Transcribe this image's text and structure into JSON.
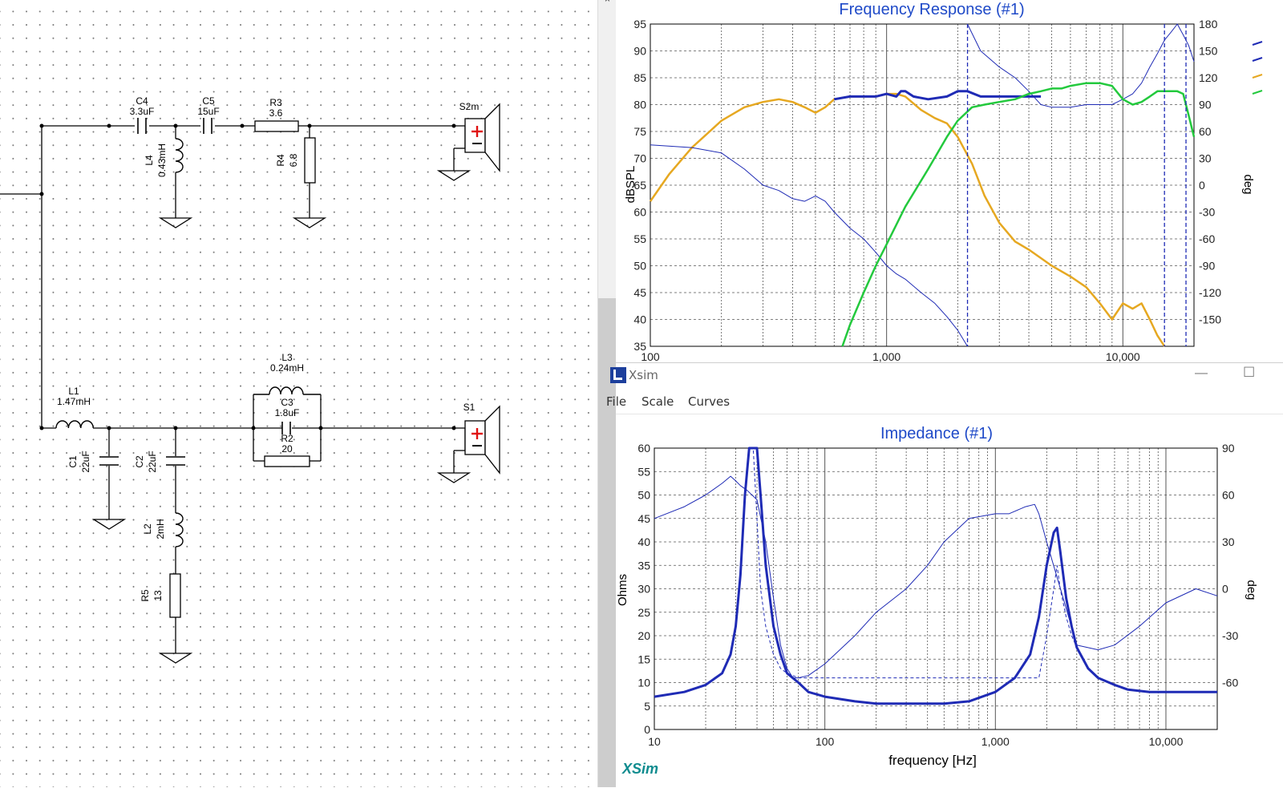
{
  "colors": {
    "blue": "#1f2bb5",
    "orange": "#e6a821",
    "green": "#23c93d",
    "title_blue": "#1f4ac8",
    "brand": "#0f8c8f",
    "speaker_plus": "#e01010"
  },
  "schematic": {
    "c4": {
      "name": "C4",
      "value": "3.3uF"
    },
    "c5": {
      "name": "C5",
      "value": "15uF"
    },
    "r3": {
      "name": "R3",
      "value": "3.6"
    },
    "l4": {
      "name": "L4",
      "value": "0.43mH"
    },
    "r4": {
      "name": "R4",
      "value": "6.8"
    },
    "s2m": {
      "name": "S2m"
    },
    "l1": {
      "name": "L1",
      "value": "1.47mH"
    },
    "l3": {
      "name": "L3",
      "value": "0.24mH"
    },
    "c3": {
      "name": "C3",
      "value": "1.8uF"
    },
    "r2": {
      "name": "R2",
      "value": "20"
    },
    "s1": {
      "name": "S1"
    },
    "c1": {
      "name": "C1",
      "value": "22uF"
    },
    "c2": {
      "name": "C2",
      "value": "22uF"
    },
    "l2": {
      "name": "L2",
      "value": "2mH"
    },
    "r5": {
      "name": "R5",
      "value": "13"
    }
  },
  "splitter": {
    "arrow": "⌃"
  },
  "xsim_window": {
    "title": "Xsim",
    "icon": "xsim-app-icon",
    "minimize": "—",
    "maximize": "☐",
    "menu": {
      "file": "File",
      "scale": "Scale",
      "curves": "Curves"
    },
    "brand": "XSim"
  },
  "chart_data": [
    {
      "type": "line",
      "title": "Frequency Response (#1)",
      "xscale": "log",
      "xlim": [
        100,
        20000
      ],
      "xticks_visible": [
        "100",
        "1,000",
        "10,000"
      ],
      "ylabel": "dBSPL",
      "ylim": [
        35,
        95
      ],
      "yticks": [
        35,
        40,
        45,
        50,
        55,
        60,
        65,
        70,
        75,
        80,
        85,
        90,
        95
      ],
      "y2label": "deg",
      "y2lim": [
        -180,
        180
      ],
      "y2ticks": [
        -150,
        -120,
        -90,
        -60,
        -30,
        0,
        30,
        60,
        90,
        120,
        150,
        180
      ],
      "grid": true,
      "series": [
        {
          "color": "#e6a821",
          "x": [
            100,
            120,
            150,
            200,
            250,
            300,
            350,
            400,
            450,
            500,
            550,
            600,
            700,
            800,
            900,
            1000,
            1100,
            1200,
            1400,
            1600,
            1800,
            2000,
            2300,
            2600,
            3000,
            3500,
            4000,
            5000,
            6000,
            7000,
            8000,
            9000,
            10000,
            11000,
            12000,
            13000,
            14000,
            15000
          ],
          "y": [
            62,
            67,
            72,
            77,
            79.5,
            80.5,
            81,
            80.5,
            79.5,
            78.5,
            79.5,
            81,
            81.5,
            81.5,
            81.5,
            82,
            82,
            81.5,
            79,
            77.5,
            76.5,
            74,
            69,
            63,
            58,
            54.5,
            53,
            50,
            48,
            46,
            43,
            40,
            43,
            42,
            43,
            40,
            37,
            35
          ]
        },
        {
          "color": "#1f2bb5",
          "width": 3,
          "x": [
            600,
            700,
            800,
            900,
            1000,
            1100,
            1150,
            1200,
            1300,
            1500,
            1800,
            2000,
            2200,
            2500,
            3000,
            3500,
            4000,
            4500
          ],
          "y": [
            81,
            81.5,
            81.5,
            81.5,
            82,
            81.5,
            82.5,
            82.5,
            81.5,
            81,
            81.5,
            82.5,
            82.5,
            81.5,
            81.5,
            81.5,
            81.5,
            81.5
          ]
        },
        {
          "color": "#1f2bb5",
          "width": 1,
          "x": [
            100,
            150,
            200,
            250,
            300,
            350,
            400,
            450,
            500,
            550,
            600,
            700,
            800,
            900,
            1000,
            1100,
            1200,
            1400,
            1600,
            1800,
            2000,
            2200
          ],
          "y": [
            72.5,
            72,
            71,
            68,
            65,
            64,
            62.5,
            62,
            63,
            62,
            60,
            57,
            55,
            52.5,
            50,
            48.5,
            47.5,
            45,
            43,
            40.5,
            38,
            35
          ]
        },
        {
          "color": "#1f2bb5",
          "width": 1,
          "x": [
            2200,
            2500,
            3000,
            3500,
            4000,
            4500,
            5000,
            6000,
            7000,
            8000,
            9000,
            10000,
            11000,
            12000,
            13000,
            14000,
            15000,
            16000,
            17000,
            18000,
            19000,
            20000
          ],
          "y": [
            95,
            90,
            87,
            85,
            82.5,
            80,
            79.5,
            79.5,
            80,
            80,
            80,
            81,
            82,
            84,
            87,
            89.5,
            92,
            93.5,
            95,
            93,
            91,
            88
          ]
        },
        {
          "color": "#23c93d",
          "x": [
            650,
            700,
            800,
            900,
            1000,
            1200,
            1500,
            1800,
            2000,
            2300,
            2600,
            3000,
            3500,
            4000,
            4500,
            5000,
            5500,
            6000,
            7000,
            8000,
            9000,
            10000,
            11000,
            12000,
            13000,
            14000,
            15000,
            16000,
            17000,
            18000,
            19000,
            20000
          ],
          "y": [
            35,
            39,
            45,
            50,
            54,
            61,
            68,
            74,
            77,
            79.5,
            80,
            80.5,
            81,
            82,
            82.5,
            83,
            83,
            83.5,
            84,
            84,
            83.5,
            81,
            80,
            80.5,
            81.5,
            82.5,
            82.5,
            82.5,
            82.5,
            82,
            78,
            74
          ]
        }
      ],
      "markers_x": [
        2200,
        15000,
        18500
      ]
    },
    {
      "type": "line",
      "title": "Impedance (#1)",
      "xlabel": "frequency [Hz]",
      "xscale": "log",
      "xlim": [
        10,
        20000
      ],
      "xticks": [
        "10",
        "100",
        "1,000",
        "10,000"
      ],
      "ylabel": "Ohms",
      "ylim": [
        0,
        60
      ],
      "yticks": [
        0,
        5,
        10,
        15,
        20,
        25,
        30,
        35,
        40,
        45,
        50,
        55,
        60
      ],
      "y2label": "deg",
      "y2lim": [
        -90,
        90
      ],
      "y2ticks": [
        -60,
        -30,
        0,
        30,
        60,
        90
      ],
      "grid": true,
      "series": [
        {
          "color": "#1f2bb5",
          "width": 3,
          "x": [
            10,
            15,
            20,
            25,
            28,
            30,
            32,
            34,
            36,
            38,
            40,
            42,
            45,
            50,
            55,
            60,
            70,
            80,
            100,
            150,
            200,
            300,
            500,
            700,
            1000,
            1300,
            1600,
            1800,
            2000,
            2200,
            2300,
            2400,
            2600,
            2800,
            3000,
            3500,
            4000,
            5000,
            6000,
            8000,
            10000,
            15000,
            20000
          ],
          "y": [
            7,
            8,
            9.5,
            12,
            16,
            22,
            33,
            50,
            60,
            60,
            60,
            50,
            35,
            22,
            16,
            12,
            10,
            8,
            7,
            6,
            5.5,
            5.5,
            5.5,
            6,
            8,
            11,
            16,
            24,
            35,
            42,
            43,
            38,
            28,
            22,
            17.5,
            13,
            11,
            9.5,
            8.5,
            8,
            8,
            8,
            8
          ]
        },
        {
          "color": "#1f2bb5",
          "width": 1,
          "dash": true,
          "x": [
            30,
            32,
            34,
            36,
            38,
            40,
            42,
            45,
            50,
            55,
            60,
            70,
            80,
            100,
            150,
            200,
            300,
            500,
            700,
            1000,
            1300,
            1600,
            1800,
            2000,
            2200,
            2300,
            2400,
            2600,
            2800,
            3000,
            3500,
            4000,
            5000
          ],
          "y": [
            22,
            33,
            50,
            60,
            60,
            45,
            30,
            22,
            16,
            13,
            12,
            11,
            11,
            11,
            11,
            11,
            11,
            11,
            11,
            11,
            11,
            11,
            11,
            20,
            30,
            35,
            30,
            24,
            20,
            17.5,
            13,
            11,
            9.5
          ]
        },
        {
          "color": "#1f2bb5",
          "width": 1,
          "x": [
            10,
            15,
            20,
            25,
            28,
            30,
            32,
            35,
            40,
            45,
            50,
            55,
            60,
            65,
            70,
            80,
            100,
            150,
            200,
            300,
            400,
            500,
            700,
            1000,
            1200,
            1500,
            1700,
            1800,
            2000,
            2500,
            3000,
            4000,
            5000,
            7000,
            10000,
            15000,
            20000
          ],
          "y": [
            45,
            47.5,
            50,
            52.5,
            54,
            53,
            52,
            51,
            49,
            40,
            28,
            18,
            13,
            11,
            11,
            11.5,
            14,
            20,
            25,
            30,
            35,
            40,
            45,
            46,
            46,
            47.5,
            48,
            46,
            40,
            28,
            18,
            17,
            18,
            22,
            27,
            30,
            28.5
          ]
        }
      ]
    }
  ]
}
